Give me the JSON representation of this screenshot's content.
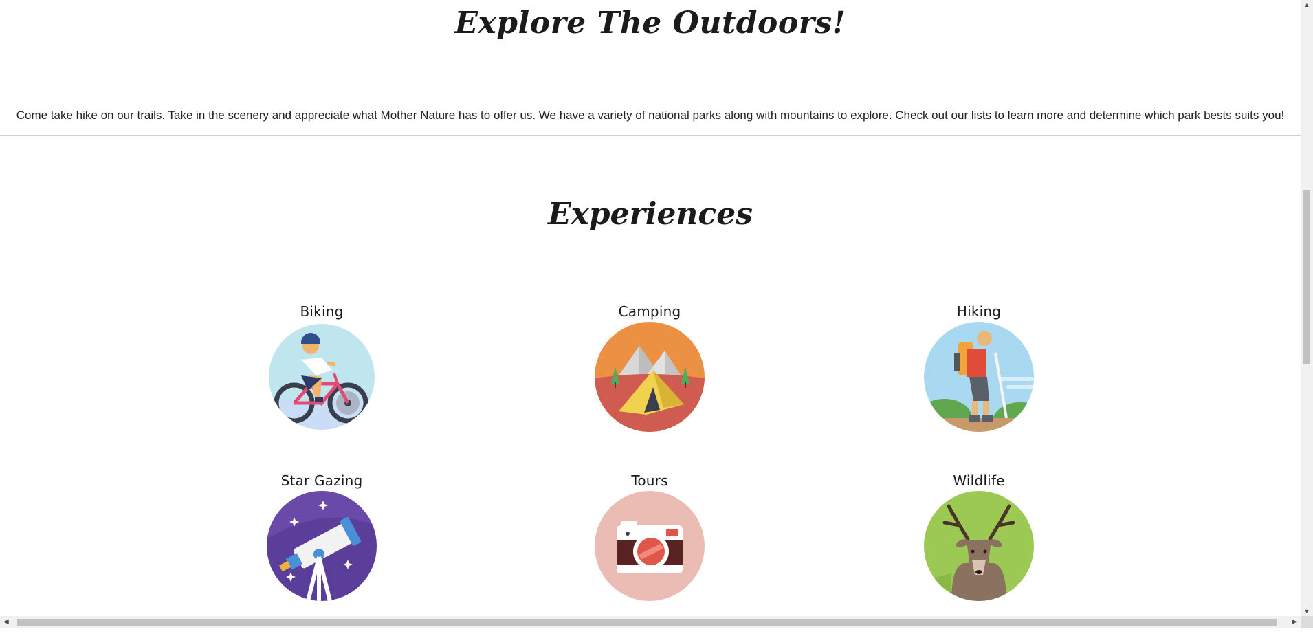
{
  "header": {
    "title": "Explore The Outdoors!"
  },
  "intro": {
    "text": "Come take hike on our trails. Take in the scenery and appreciate what Mother Nature has to offer us. We have a variety of national parks along with mountains to explore. Check out our lists to learn more and determine which park bests suits you!"
  },
  "experiences": {
    "heading": "Experiences",
    "items": [
      {
        "label": "Biking",
        "icon": "biking-icon"
      },
      {
        "label": "Camping",
        "icon": "camping-icon"
      },
      {
        "label": "Hiking",
        "icon": "hiking-icon"
      },
      {
        "label": "Star Gazing",
        "icon": "star-gazing-icon"
      },
      {
        "label": "Tours",
        "icon": "camera-icon"
      },
      {
        "label": "Wildlife",
        "icon": "deer-icon"
      }
    ]
  },
  "scrollbars": {
    "vertical_up": "▲",
    "vertical_down": "▼",
    "horizontal_left": "◀",
    "horizontal_right": "▶"
  }
}
